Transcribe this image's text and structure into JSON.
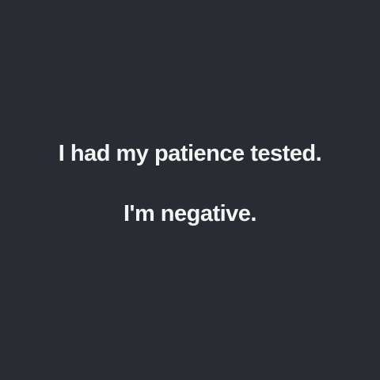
{
  "colors": {
    "background": "#2a2c33",
    "text": "#f4f4f4"
  },
  "joke": {
    "setup": "I had my patience tested.",
    "punchline": "I'm negative."
  }
}
